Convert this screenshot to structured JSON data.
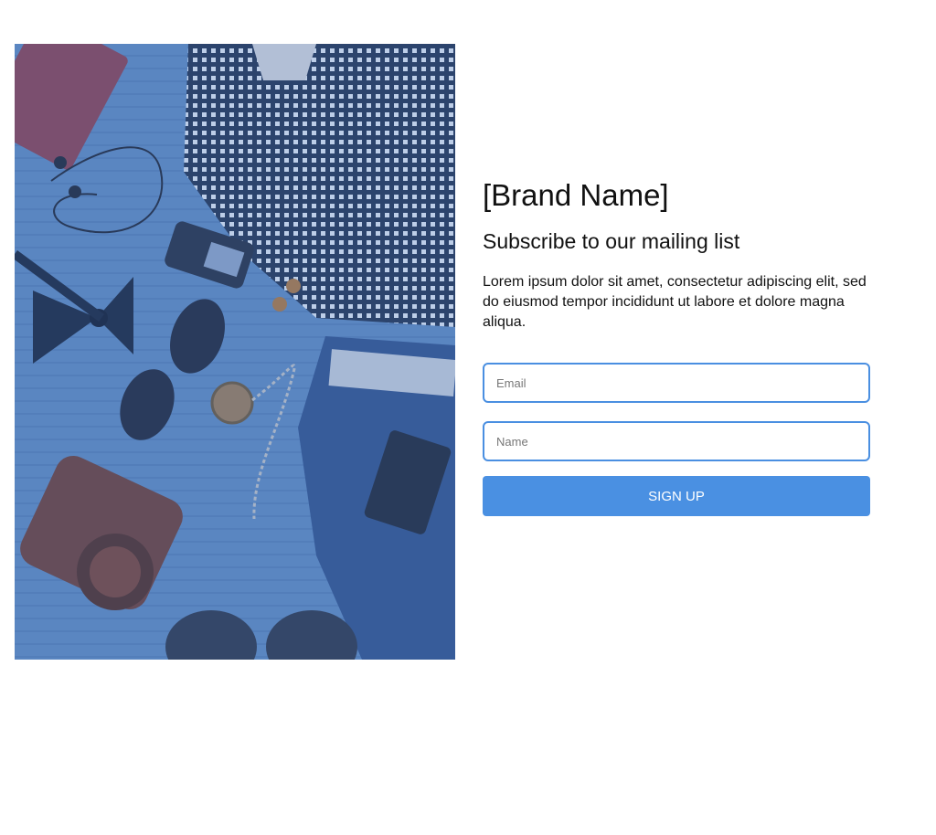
{
  "hero": {
    "image": "flat-lay-outfit-photo",
    "tint": "#5c86bd"
  },
  "brand": {
    "name": "[Brand Name]"
  },
  "subscribe": {
    "heading": "Subscribe to our mailing list",
    "description": "Lorem ipsum dolor sit amet, consectetur adipiscing elit, sed do eiusmod tempor incididunt ut labore et dolore magna aliqua."
  },
  "form": {
    "email_placeholder": "Email",
    "name_placeholder": "Name",
    "submit_label": "SIGN UP"
  },
  "colors": {
    "accent": "#4a90e2",
    "input_border": "#4a8fe1"
  }
}
